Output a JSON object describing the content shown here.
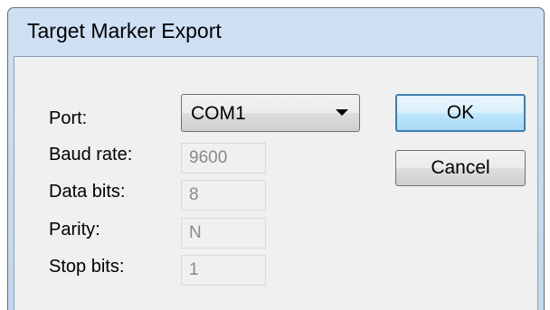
{
  "window": {
    "title": "Target Marker Export"
  },
  "form": {
    "port": {
      "label": "Port:",
      "value": "COM1"
    },
    "baud_rate": {
      "label": "Baud rate:",
      "value": "9600"
    },
    "data_bits": {
      "label": "Data bits:",
      "value": "8"
    },
    "parity": {
      "label": "Parity:",
      "value": "N"
    },
    "stop_bits": {
      "label": "Stop bits:",
      "value": "1"
    }
  },
  "buttons": {
    "ok_label": "OK",
    "cancel_label": "Cancel"
  },
  "icons": {
    "dropdown": "chevron-down-icon"
  },
  "colors": {
    "title_bar": "#c2d8f0",
    "client_bg": "#f0f0f0",
    "default_button_border": "#3c7fb1",
    "disabled_text": "#8a8a8a"
  }
}
